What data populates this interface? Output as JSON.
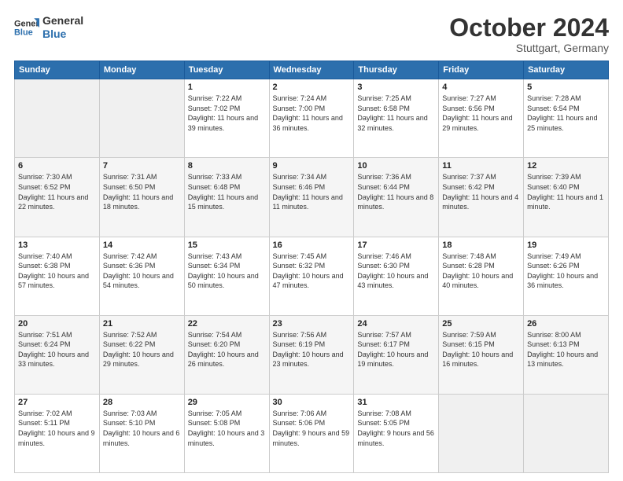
{
  "header": {
    "logo_line1": "General",
    "logo_line2": "Blue",
    "month": "October 2024",
    "location": "Stuttgart, Germany"
  },
  "days_of_week": [
    "Sunday",
    "Monday",
    "Tuesday",
    "Wednesday",
    "Thursday",
    "Friday",
    "Saturday"
  ],
  "weeks": [
    [
      {
        "day": "",
        "info": ""
      },
      {
        "day": "",
        "info": ""
      },
      {
        "day": "1",
        "info": "Sunrise: 7:22 AM\nSunset: 7:02 PM\nDaylight: 11 hours and 39 minutes."
      },
      {
        "day": "2",
        "info": "Sunrise: 7:24 AM\nSunset: 7:00 PM\nDaylight: 11 hours and 36 minutes."
      },
      {
        "day": "3",
        "info": "Sunrise: 7:25 AM\nSunset: 6:58 PM\nDaylight: 11 hours and 32 minutes."
      },
      {
        "day": "4",
        "info": "Sunrise: 7:27 AM\nSunset: 6:56 PM\nDaylight: 11 hours and 29 minutes."
      },
      {
        "day": "5",
        "info": "Sunrise: 7:28 AM\nSunset: 6:54 PM\nDaylight: 11 hours and 25 minutes."
      }
    ],
    [
      {
        "day": "6",
        "info": "Sunrise: 7:30 AM\nSunset: 6:52 PM\nDaylight: 11 hours and 22 minutes."
      },
      {
        "day": "7",
        "info": "Sunrise: 7:31 AM\nSunset: 6:50 PM\nDaylight: 11 hours and 18 minutes."
      },
      {
        "day": "8",
        "info": "Sunrise: 7:33 AM\nSunset: 6:48 PM\nDaylight: 11 hours and 15 minutes."
      },
      {
        "day": "9",
        "info": "Sunrise: 7:34 AM\nSunset: 6:46 PM\nDaylight: 11 hours and 11 minutes."
      },
      {
        "day": "10",
        "info": "Sunrise: 7:36 AM\nSunset: 6:44 PM\nDaylight: 11 hours and 8 minutes."
      },
      {
        "day": "11",
        "info": "Sunrise: 7:37 AM\nSunset: 6:42 PM\nDaylight: 11 hours and 4 minutes."
      },
      {
        "day": "12",
        "info": "Sunrise: 7:39 AM\nSunset: 6:40 PM\nDaylight: 11 hours and 1 minute."
      }
    ],
    [
      {
        "day": "13",
        "info": "Sunrise: 7:40 AM\nSunset: 6:38 PM\nDaylight: 10 hours and 57 minutes."
      },
      {
        "day": "14",
        "info": "Sunrise: 7:42 AM\nSunset: 6:36 PM\nDaylight: 10 hours and 54 minutes."
      },
      {
        "day": "15",
        "info": "Sunrise: 7:43 AM\nSunset: 6:34 PM\nDaylight: 10 hours and 50 minutes."
      },
      {
        "day": "16",
        "info": "Sunrise: 7:45 AM\nSunset: 6:32 PM\nDaylight: 10 hours and 47 minutes."
      },
      {
        "day": "17",
        "info": "Sunrise: 7:46 AM\nSunset: 6:30 PM\nDaylight: 10 hours and 43 minutes."
      },
      {
        "day": "18",
        "info": "Sunrise: 7:48 AM\nSunset: 6:28 PM\nDaylight: 10 hours and 40 minutes."
      },
      {
        "day": "19",
        "info": "Sunrise: 7:49 AM\nSunset: 6:26 PM\nDaylight: 10 hours and 36 minutes."
      }
    ],
    [
      {
        "day": "20",
        "info": "Sunrise: 7:51 AM\nSunset: 6:24 PM\nDaylight: 10 hours and 33 minutes."
      },
      {
        "day": "21",
        "info": "Sunrise: 7:52 AM\nSunset: 6:22 PM\nDaylight: 10 hours and 29 minutes."
      },
      {
        "day": "22",
        "info": "Sunrise: 7:54 AM\nSunset: 6:20 PM\nDaylight: 10 hours and 26 minutes."
      },
      {
        "day": "23",
        "info": "Sunrise: 7:56 AM\nSunset: 6:19 PM\nDaylight: 10 hours and 23 minutes."
      },
      {
        "day": "24",
        "info": "Sunrise: 7:57 AM\nSunset: 6:17 PM\nDaylight: 10 hours and 19 minutes."
      },
      {
        "day": "25",
        "info": "Sunrise: 7:59 AM\nSunset: 6:15 PM\nDaylight: 10 hours and 16 minutes."
      },
      {
        "day": "26",
        "info": "Sunrise: 8:00 AM\nSunset: 6:13 PM\nDaylight: 10 hours and 13 minutes."
      }
    ],
    [
      {
        "day": "27",
        "info": "Sunrise: 7:02 AM\nSunset: 5:11 PM\nDaylight: 10 hours and 9 minutes."
      },
      {
        "day": "28",
        "info": "Sunrise: 7:03 AM\nSunset: 5:10 PM\nDaylight: 10 hours and 6 minutes."
      },
      {
        "day": "29",
        "info": "Sunrise: 7:05 AM\nSunset: 5:08 PM\nDaylight: 10 hours and 3 minutes."
      },
      {
        "day": "30",
        "info": "Sunrise: 7:06 AM\nSunset: 5:06 PM\nDaylight: 9 hours and 59 minutes."
      },
      {
        "day": "31",
        "info": "Sunrise: 7:08 AM\nSunset: 5:05 PM\nDaylight: 9 hours and 56 minutes."
      },
      {
        "day": "",
        "info": ""
      },
      {
        "day": "",
        "info": ""
      }
    ]
  ]
}
